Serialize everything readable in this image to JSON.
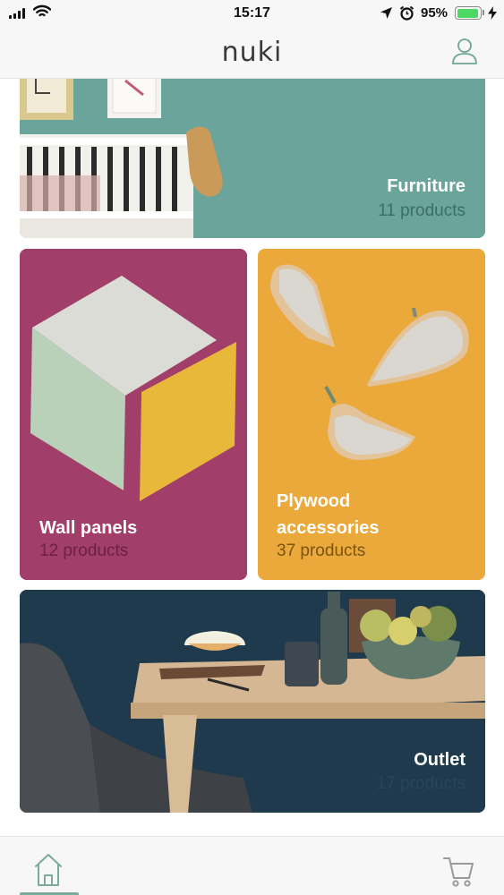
{
  "status_bar": {
    "time": "15:17",
    "battery_percent": "95%",
    "battery_level": 0.95,
    "icons": [
      "signal-icon",
      "wifi-icon",
      "location-arrow-icon",
      "alarm-icon",
      "battery-icon",
      "charging-bolt-icon"
    ]
  },
  "header": {
    "logo_text": "nuki",
    "profile_icon": "user-icon"
  },
  "categories": [
    {
      "title": "Furniture",
      "count": "11 products"
    },
    {
      "title": "Wall panels",
      "count": "12 products"
    },
    {
      "title_line1": "Plywood",
      "title_line2": "accessories",
      "count": "37 products"
    },
    {
      "title": "Outlet",
      "count": "17 products"
    }
  ],
  "tab_bar": {
    "items": [
      {
        "icon": "home-icon",
        "active": true
      },
      {
        "icon": "cart-icon",
        "active": false
      }
    ]
  },
  "colors": {
    "accent": "#7bab9f",
    "furniture_bg": "#6aa49b",
    "wall_bg": "#a13e6a",
    "plywood_bg": "#eaa93a",
    "outlet_bg": "#1f3a4c"
  }
}
